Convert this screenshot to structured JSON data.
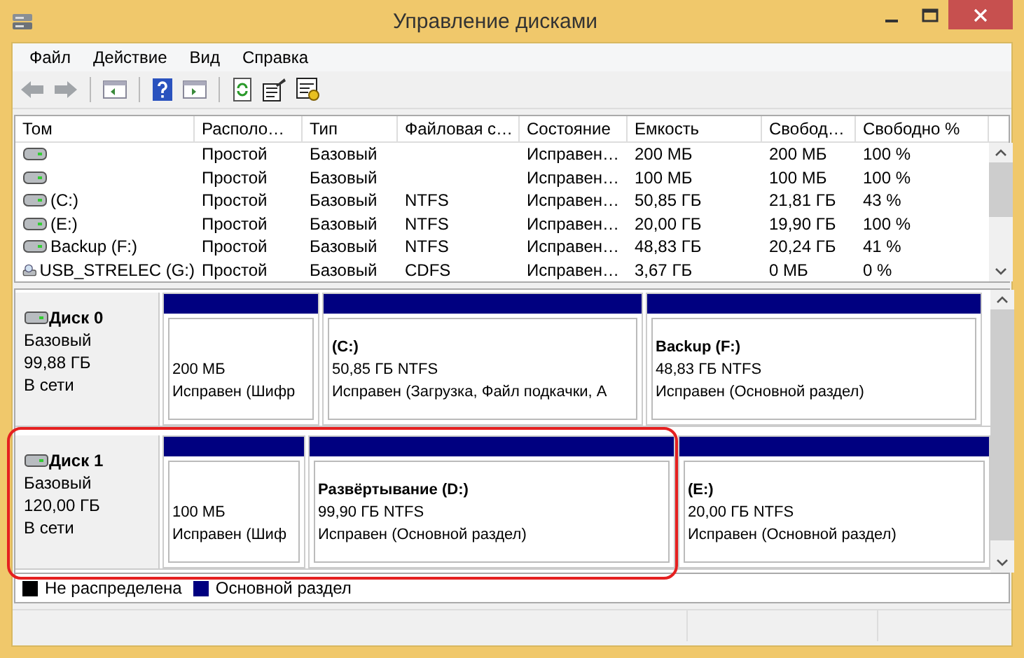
{
  "window": {
    "title": "Управление дисками"
  },
  "menu": [
    "Файл",
    "Действие",
    "Вид",
    "Справка"
  ],
  "table": {
    "columns": [
      "Том",
      "Располо…",
      "Тип",
      "Файловая с…",
      "Состояние",
      "Емкость",
      "Свобод…",
      "Свободно %"
    ],
    "rows": [
      {
        "kind": "drive",
        "cells": [
          null,
          "Простой",
          "Базовый",
          null,
          "Исправен…",
          "200 МБ",
          "200 МБ",
          "100 %"
        ]
      },
      {
        "kind": "drive",
        "cells": [
          null,
          "Простой",
          "Базовый",
          null,
          "Исправен…",
          "100 МБ",
          "100 МБ",
          "100 %"
        ]
      },
      {
        "kind": "drive",
        "cells": [
          "(C:)",
          "Простой",
          "Базовый",
          "NTFS",
          "Исправен…",
          "50,85 ГБ",
          "21,81 ГБ",
          "43 %"
        ]
      },
      {
        "kind": "drive",
        "cells": [
          "(E:)",
          "Простой",
          "Базовый",
          "NTFS",
          "Исправен…",
          "20,00 ГБ",
          "19,90 ГБ",
          "100 %"
        ]
      },
      {
        "kind": "drive",
        "cells": [
          "Backup (F:)",
          "Простой",
          "Базовый",
          "NTFS",
          "Исправен…",
          "48,83 ГБ",
          "20,24 ГБ",
          "41 %"
        ]
      },
      {
        "kind": "usb",
        "cells": [
          "USB_STRELEC (G:)",
          "Простой",
          "Базовый",
          "CDFS",
          "Исправен…",
          "3,67 ГБ",
          "0 МБ",
          "0 %"
        ]
      }
    ]
  },
  "disks": [
    {
      "name": "Диск 0",
      "type": "Базовый",
      "size": "99,88 ГБ",
      "status": "В сети",
      "highlighted": false,
      "partitions": [
        {
          "size": "200 МБ",
          "status": "Исправен (Шифр"
        },
        {
          "name": "(C:)",
          "size": "50,85 ГБ NTFS",
          "status": "Исправен (Загрузка, Файл подкачки, А"
        },
        {
          "name": "Backup  (F:)",
          "size": "48,83 ГБ NTFS",
          "status": "Исправен (Основной раздел)"
        }
      ]
    },
    {
      "name": "Диск 1",
      "type": "Базовый",
      "size": "120,00 ГБ",
      "status": "В сети",
      "highlighted": true,
      "partitions": [
        {
          "size": "100 МБ",
          "status": "Исправен (Шиф"
        },
        {
          "name": "Развёртывание   (D:)",
          "size": "99,90 ГБ NTFS",
          "status": "Исправен (Основной раздел)"
        },
        {
          "name": "(E:)",
          "size": "20,00 ГБ NTFS",
          "status": "Исправен (Основной раздел)"
        }
      ]
    }
  ],
  "legend": [
    {
      "label": "Не распределена",
      "color": "#000000"
    },
    {
      "label": "Основной раздел",
      "color": "#000080"
    }
  ]
}
